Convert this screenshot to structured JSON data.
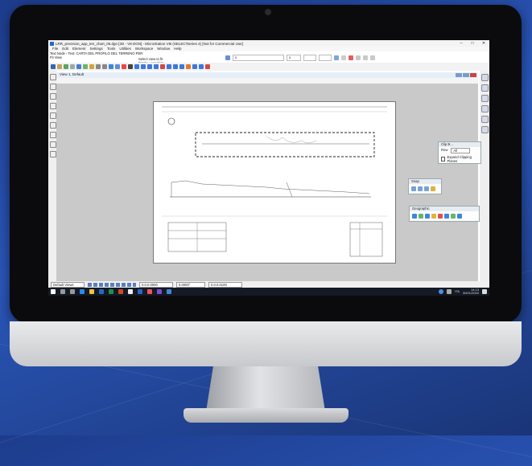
{
  "window": {
    "title": "LRR_precision_app_ten_chart_06.dgn [2D - V8 DGN] - MicroStation V8i (SELECTseries 4) [Not for Commercial Use]",
    "minimize": "–",
    "maximize": "□",
    "close": "✕"
  },
  "menu": [
    "File",
    "Edit",
    "Element",
    "Settings",
    "Tools",
    "Utilities",
    "Workspace",
    "Window",
    "Help"
  ],
  "tool_info": {
    "line1": "Text Node › Text: CARTA DEL PROFILO DEL TERRENO PER",
    "line2": "Fit View"
  },
  "tooltip": {
    "line1": "Select view to fit",
    "line2": "Display complete"
  },
  "ribbon": {
    "level_value": "0",
    "weight_value": "0"
  },
  "view": {
    "title": "View 1, Default"
  },
  "panels": {
    "clip": {
      "title": "Clip B…",
      "row_label": "Row",
      "row_value": "All",
      "checkbox_label": "Expand Clipping Planes"
    },
    "snap": {
      "title": "Snap"
    },
    "geographic": {
      "title": "Geographic"
    }
  },
  "statusbar": {
    "view_select": "Default Views",
    "field1": "0.0.0.0000",
    "field2": "0.0000°",
    "field3": "0.0.0.0100"
  },
  "taskbar": {
    "lang": "ITA",
    "time": "14:13",
    "date": "30/01/2020"
  },
  "colors": {
    "bezel": "#0b0b0d",
    "background": "#2a56b8",
    "taskbar": "#141a26",
    "accent": "#2b66c4"
  }
}
